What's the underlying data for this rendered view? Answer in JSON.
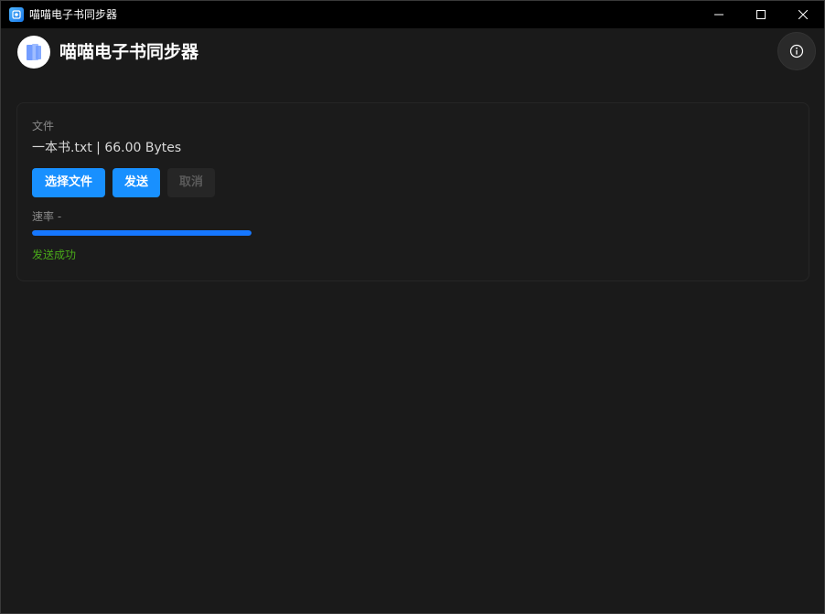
{
  "window": {
    "title": "喵喵电子书同步器"
  },
  "header": {
    "title": "喵喵电子书同步器"
  },
  "file_panel": {
    "label": "文件",
    "file_name": "一本书.txt",
    "separator": " | ",
    "file_size": "66.00 Bytes",
    "buttons": {
      "select_file": "选择文件",
      "send": "发送",
      "cancel": "取消"
    },
    "rate_label": "速率 -",
    "progress_percent": 100,
    "status": "发送成功"
  },
  "colors": {
    "accent": "#1890ff",
    "success": "#49aa19",
    "background": "#1a1a1a"
  },
  "icons": {
    "app": "book-icon",
    "info": "info-icon",
    "minimize": "minimize-icon",
    "maximize": "maximize-icon",
    "close": "close-icon"
  }
}
